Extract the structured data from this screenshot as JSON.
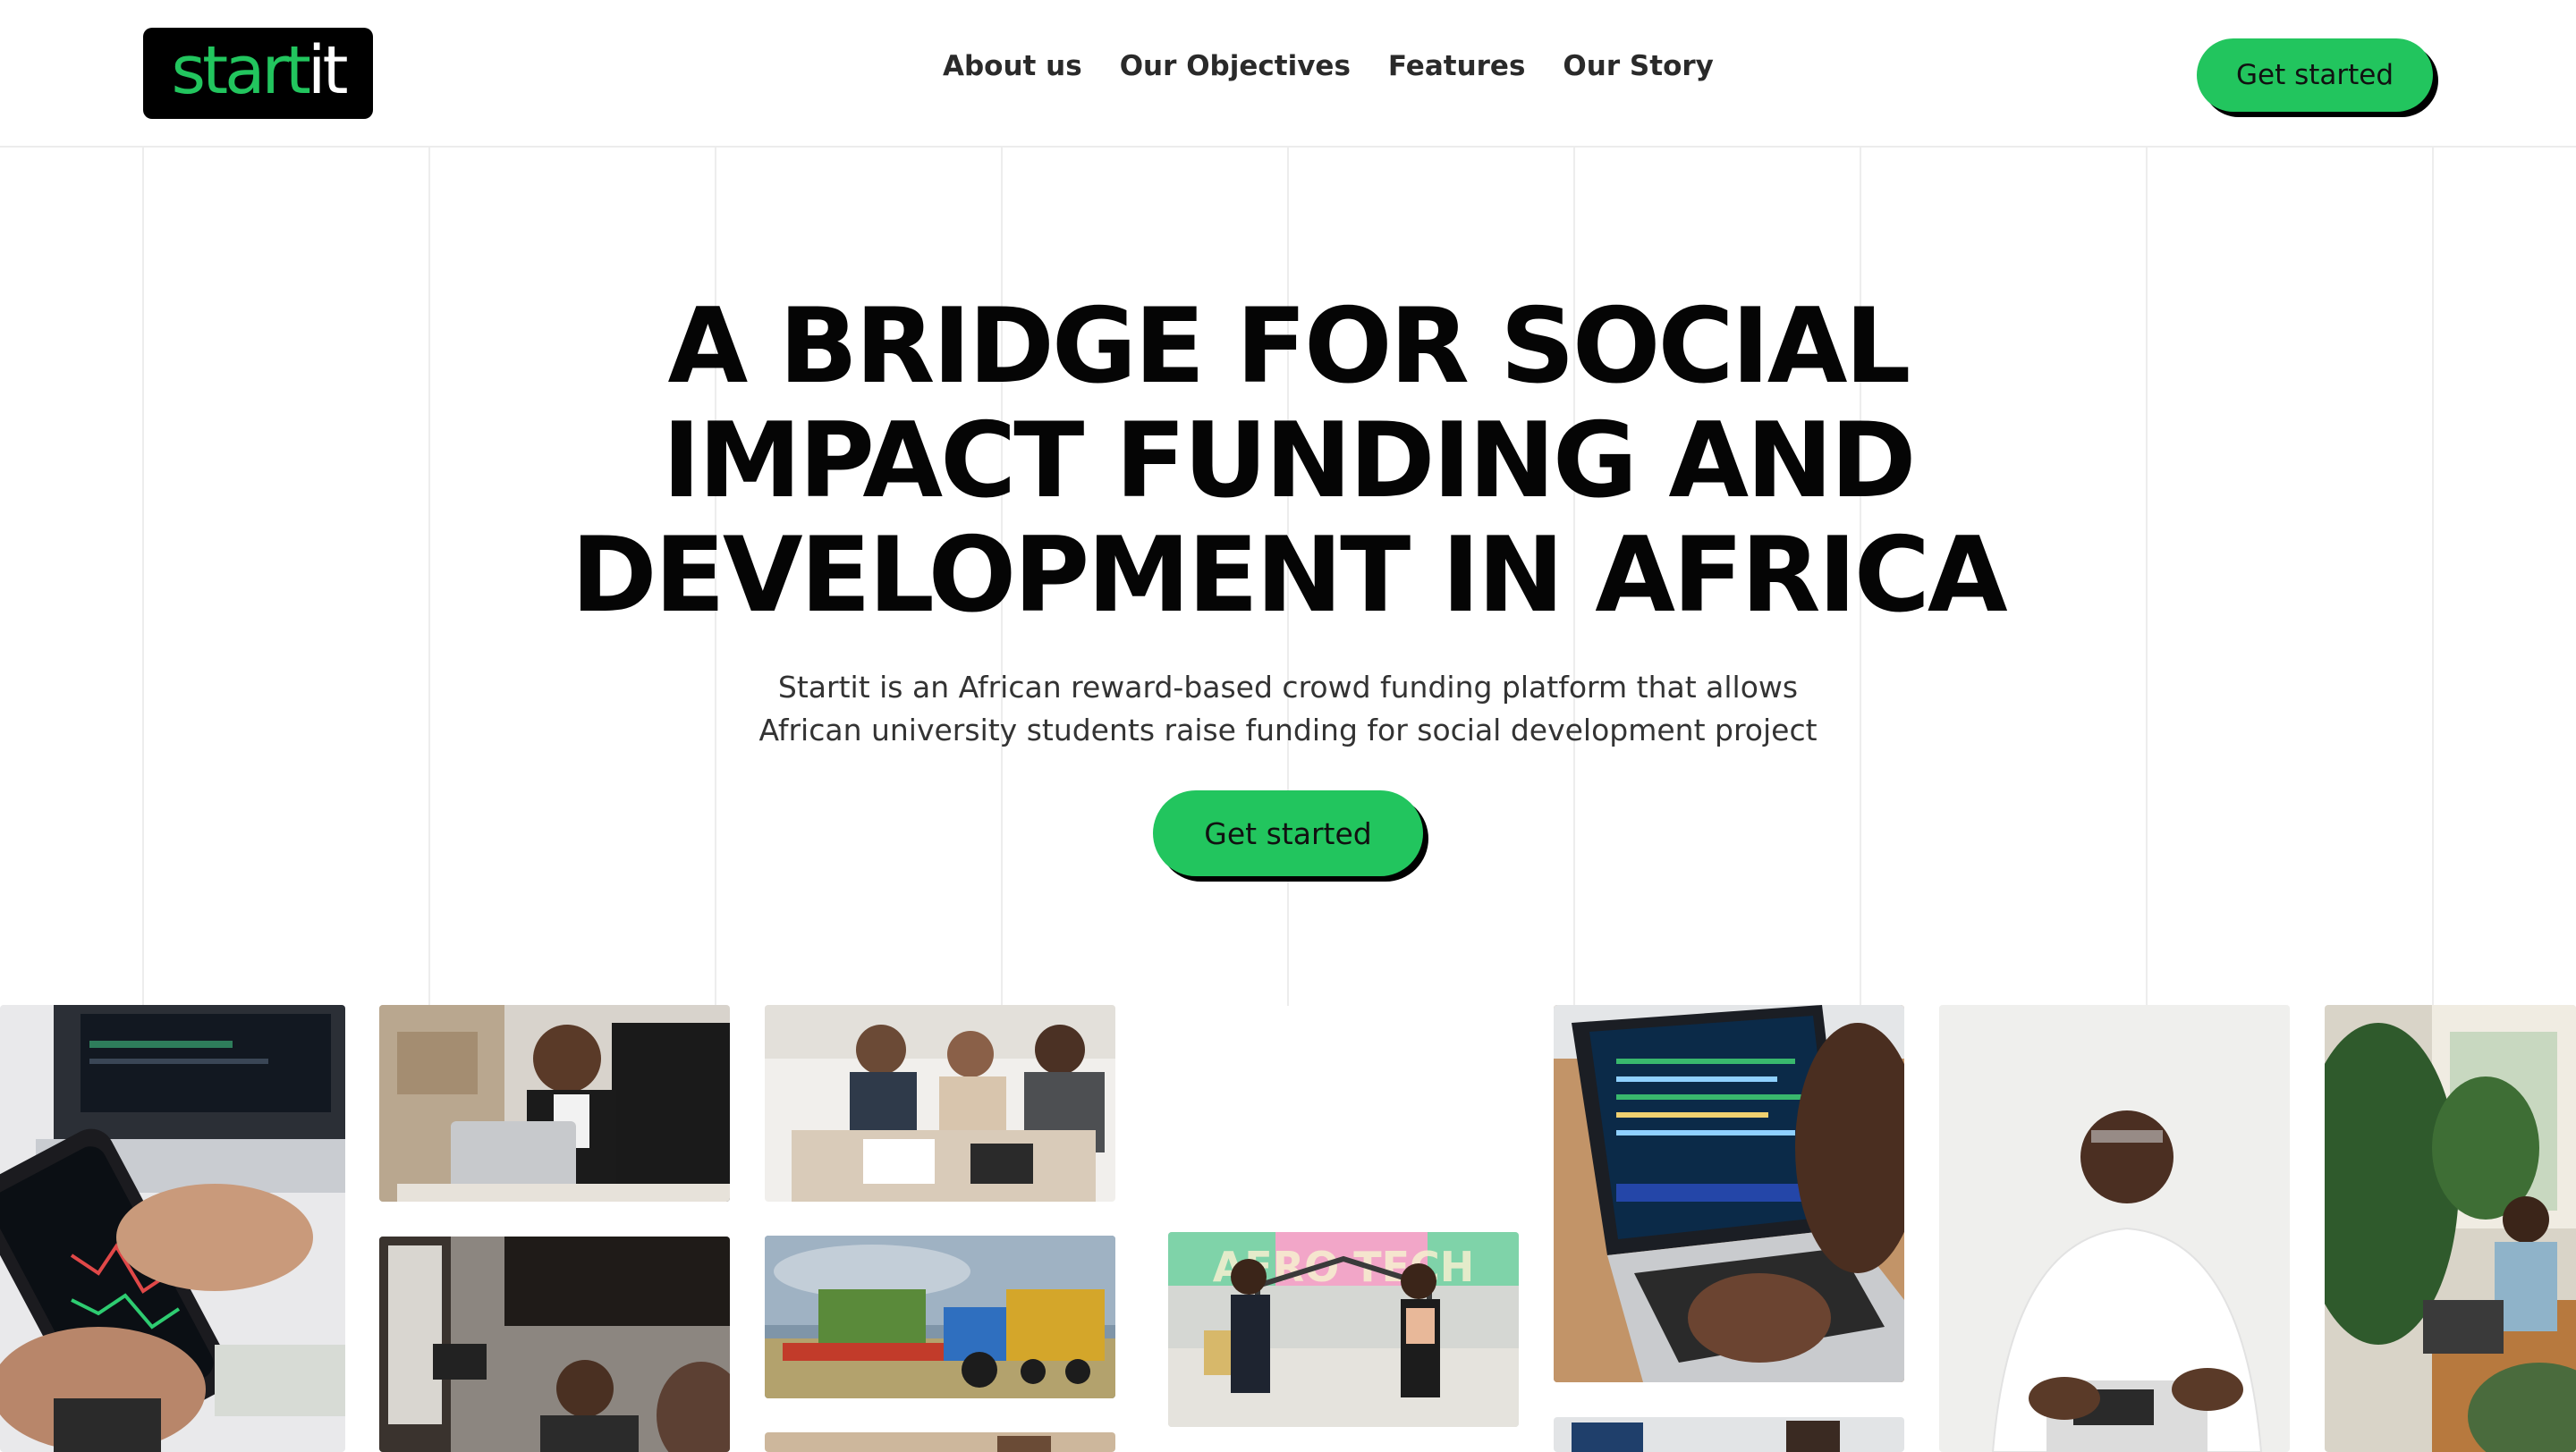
{
  "logo": {
    "part1": "start",
    "part2": "it"
  },
  "nav": {
    "items": [
      {
        "label": "About us"
      },
      {
        "label": "Our Objectives"
      },
      {
        "label": "Features"
      },
      {
        "label": "Our Story"
      }
    ]
  },
  "header": {
    "cta_label": "Get started"
  },
  "hero": {
    "title_line1": "A BRIDGE FOR SOCIAL",
    "title_line2": "IMPACT FUNDING AND",
    "title_line3": "DEVELOPMENT IN AFRICA",
    "subtitle_line1": "Startit is an African reward-based crowd funding platform that allows",
    "subtitle_line2": "African university students raise funding for social development project",
    "cta_label": "Get started"
  },
  "gallery": {
    "banner_text": "AFRO TECH"
  },
  "colors": {
    "accent": "#22c55e",
    "text": "#050505",
    "muted": "#333333"
  }
}
